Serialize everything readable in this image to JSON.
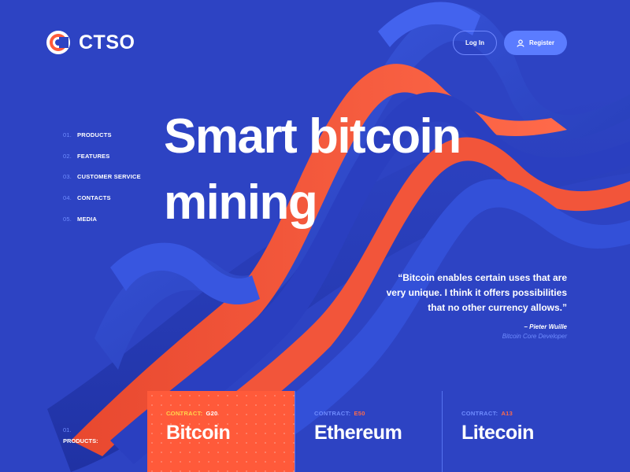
{
  "brand": {
    "name": "CTSO"
  },
  "header": {
    "login_label": "Log In",
    "register_label": "Register"
  },
  "nav": {
    "items": [
      {
        "num": "01.",
        "label": "PRODUCTS"
      },
      {
        "num": "02.",
        "label": "FEATURES"
      },
      {
        "num": "03.",
        "label": "CUSTOMER SERVICE"
      },
      {
        "num": "04.",
        "label": "CONTACTS"
      },
      {
        "num": "05.",
        "label": "MEDIA"
      }
    ]
  },
  "hero": {
    "headline_line1": "Smart bitcoin",
    "headline_line2": "mining"
  },
  "quote": {
    "line1": "“Bitcoin enables certain uses that are",
    "line2": "very unique. I think it offers possibilities",
    "line3": "that no other currency allows.”",
    "author": "– Pieter Wuille",
    "role": "Bitcoin Core Developer"
  },
  "products": {
    "num": "01.",
    "label": "PRODUCTS:",
    "cards": [
      {
        "contract_label": "CONTRACT:",
        "contract_value": "G20",
        "name": "Bitcoin"
      },
      {
        "contract_label": "CONTRACT:",
        "contract_value": "E50",
        "name": "Ethereum"
      },
      {
        "contract_label": "CONTRACT:",
        "contract_value": "A13",
        "name": "Litecoin"
      }
    ]
  },
  "colors": {
    "background": "#2d43c3",
    "accent_orange": "#ff5a3a",
    "accent_blue": "#5b7cff",
    "muted_blue": "#6f8cff"
  },
  "icons": {
    "logo": "ctso-logo-icon",
    "register": "user-icon"
  }
}
